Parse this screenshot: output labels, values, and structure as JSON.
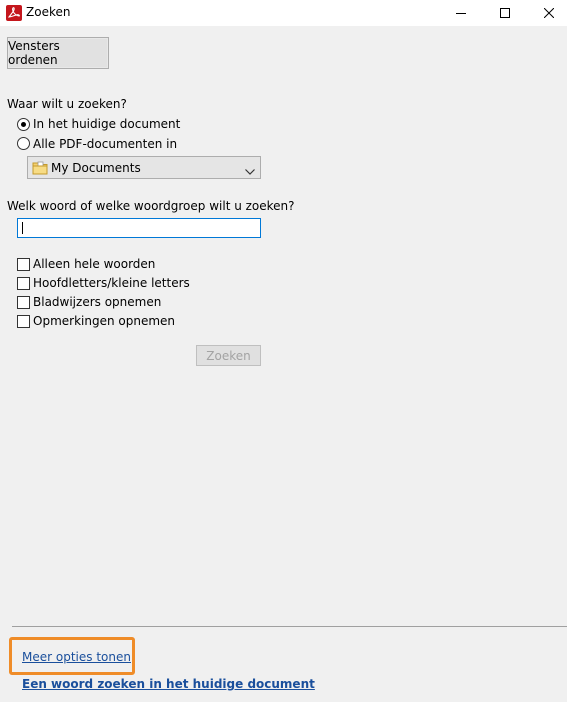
{
  "window": {
    "title": "Zoeken",
    "app_icon": "acrobat-icon",
    "controls": [
      "minimize-icon",
      "maximize-icon",
      "close-icon"
    ]
  },
  "toolbar": {
    "arrange_label": "Vensters ordenen"
  },
  "where": {
    "heading": "Waar wilt u zoeken?",
    "option_current": "In het huidige document",
    "option_all_pdfs": "Alle PDF-documenten in",
    "selected": "current",
    "folder_value": "My Documents",
    "folder_icon": "folder-icon"
  },
  "query": {
    "heading": "Welk woord of welke woordgroep wilt u zoeken?",
    "value": ""
  },
  "options": [
    {
      "label": "Alleen hele woorden",
      "checked": false
    },
    {
      "label": "Hoofdletters/kleine letters",
      "checked": false
    },
    {
      "label": "Bladwijzers opnemen",
      "checked": false
    },
    {
      "label": "Opmerkingen opnemen",
      "checked": false
    }
  ],
  "search_button": {
    "label": "Zoeken",
    "enabled": false
  },
  "footer": {
    "more_options_link": "Meer opties tonen",
    "find_in_document_link": "Een woord zoeken in het huidige document"
  },
  "colors": {
    "accent": "#0078d7",
    "highlight": "#ef8c28",
    "link": "#1a4f9c",
    "acrobat_red": "#c4161c"
  }
}
